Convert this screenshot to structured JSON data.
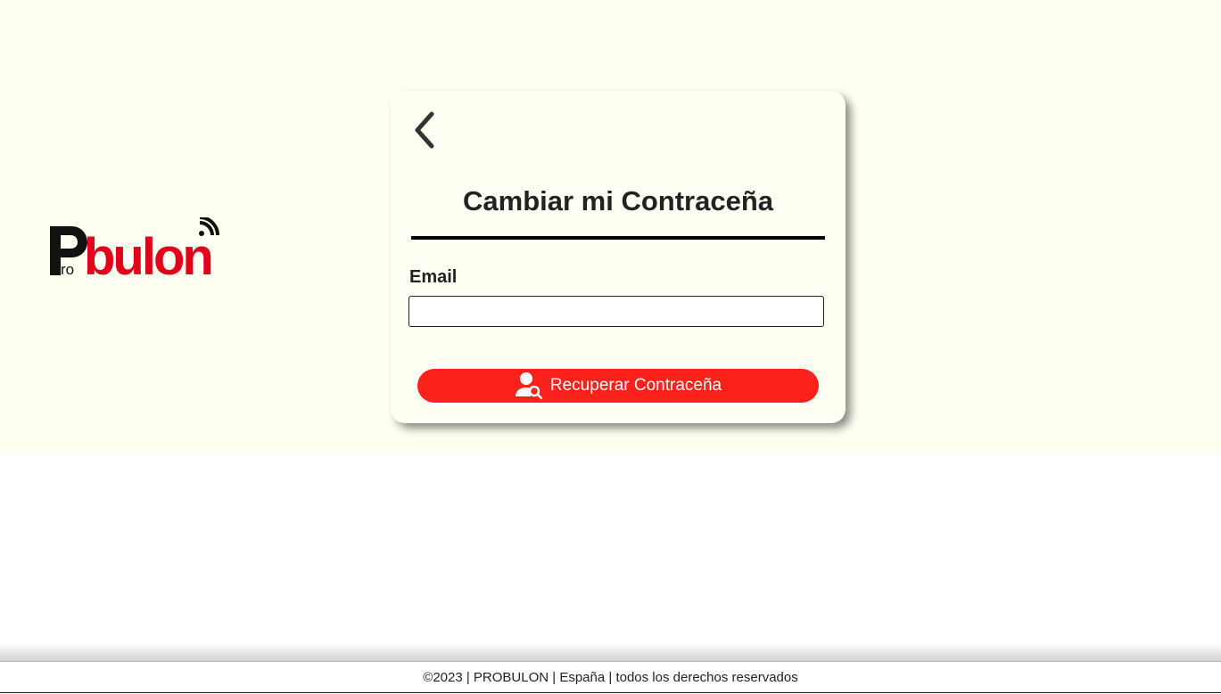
{
  "brand": {
    "logo_text": "Probulon",
    "logo_prefix": "Pro",
    "logo_main": "bulon",
    "primary_color": "#e3001b",
    "accent_color": "#fc211b"
  },
  "card": {
    "back_icon": "chevron-left-icon",
    "title": "Cambiar mi Contraceña",
    "email_label": "Email",
    "email_value": "",
    "email_placeholder": "",
    "submit_label": "Recuperar Contraceña",
    "submit_icon": "user-search-icon"
  },
  "footer": {
    "text": "©2023 | PROBULON | España | todos los derechos reservados"
  }
}
